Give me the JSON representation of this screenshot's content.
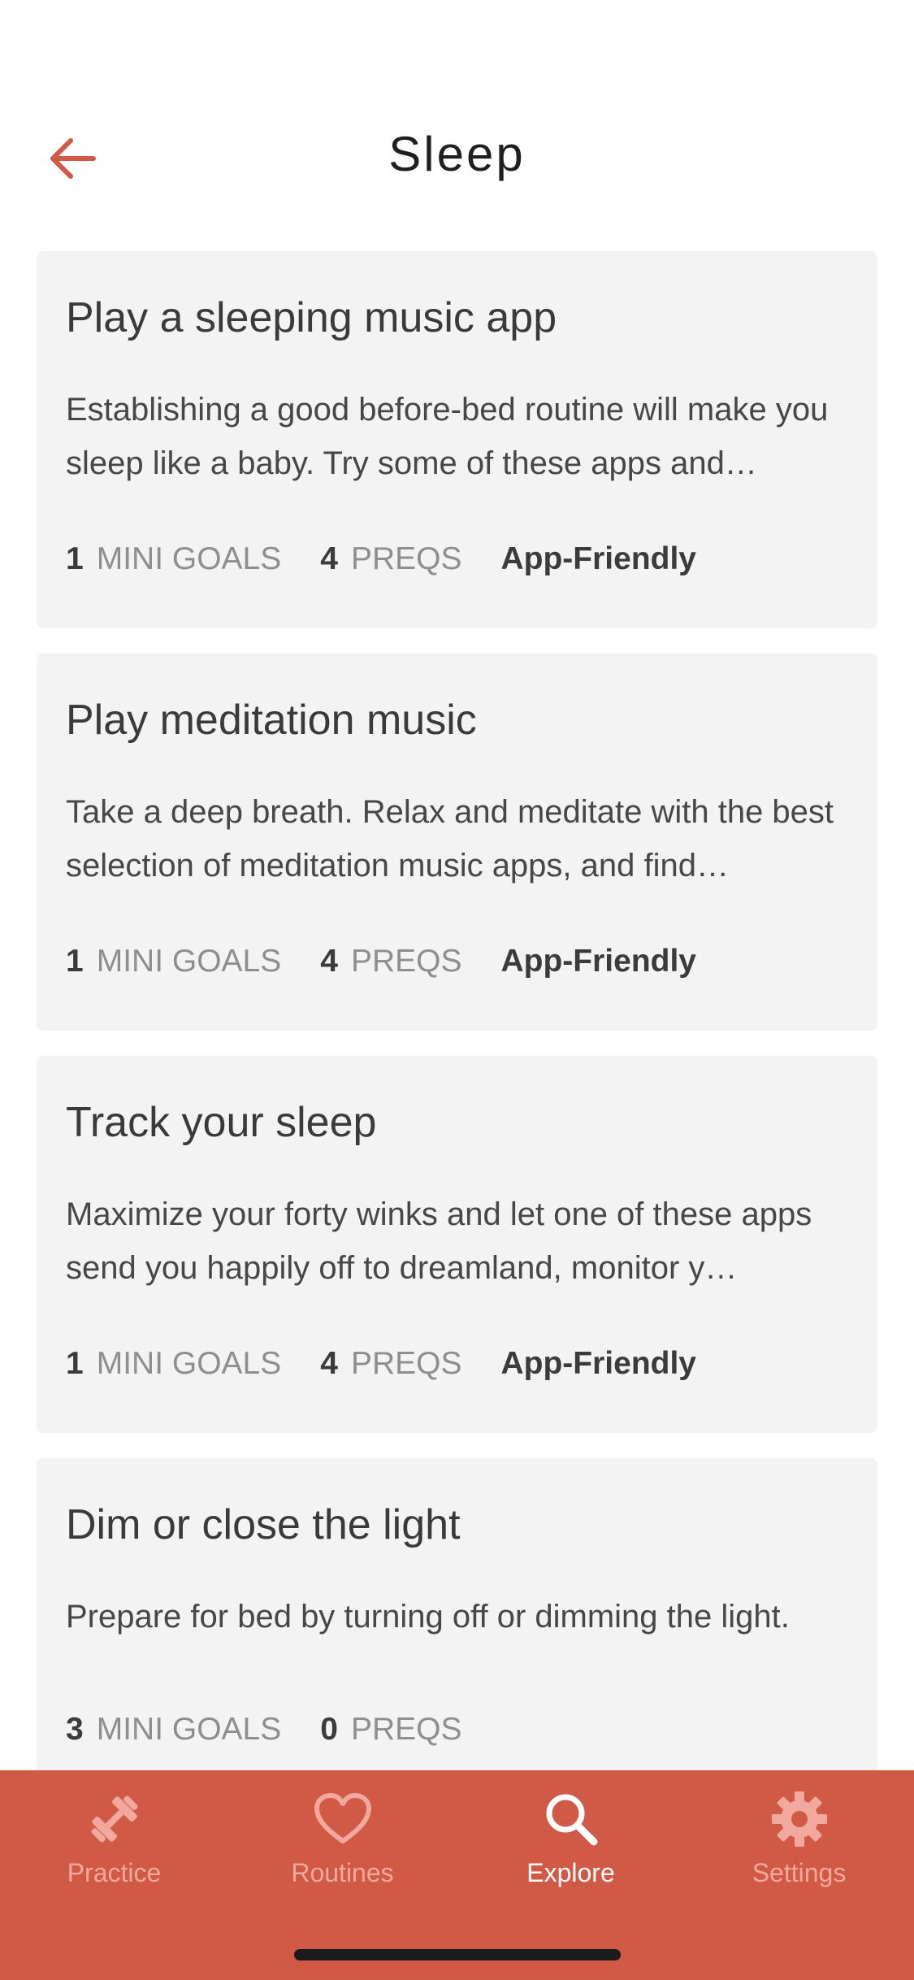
{
  "header": {
    "title": "Sleep"
  },
  "cards": [
    {
      "title": "Play a sleeping music app",
      "description": "Establishing a good before-bed routine will make you sleep like a baby. Try some of these apps and…",
      "mini_goals_count": "1",
      "mini_goals_label": "MINI GOALS",
      "preqs_count": "4",
      "preqs_label": "PREQS",
      "badge": "App-Friendly"
    },
    {
      "title": "Play meditation music",
      "description": "Take a deep breath. Relax and meditate with the best selection of meditation music apps, and find…",
      "mini_goals_count": "1",
      "mini_goals_label": "MINI GOALS",
      "preqs_count": "4",
      "preqs_label": "PREQS",
      "badge": "App-Friendly"
    },
    {
      "title": "Track your sleep",
      "description": "Maximize your forty winks and let one of these apps send you happily off to dreamland, monitor y…",
      "mini_goals_count": "1",
      "mini_goals_label": "MINI GOALS",
      "preqs_count": "4",
      "preqs_label": "PREQS",
      "badge": "App-Friendly"
    },
    {
      "title": "Dim or close the light",
      "description": "Prepare for bed by turning off or dimming the light.",
      "mini_goals_count": "3",
      "mini_goals_label": "MINI GOALS",
      "preqs_count": "0",
      "preqs_label": "PREQS"
    }
  ],
  "tabbar": {
    "items": [
      {
        "label": "Practice",
        "icon": "dumbbell-icon",
        "active": false
      },
      {
        "label": "Routines",
        "icon": "heart-icon",
        "active": false
      },
      {
        "label": "Explore",
        "icon": "search-icon",
        "active": true
      },
      {
        "label": "Settings",
        "icon": "gear-icon",
        "active": false
      }
    ]
  },
  "colors": {
    "accent": "#d05a46",
    "card_background": "#f3f3f3",
    "inactive_tab": "#f0a99c",
    "active_tab": "#ffffff"
  }
}
